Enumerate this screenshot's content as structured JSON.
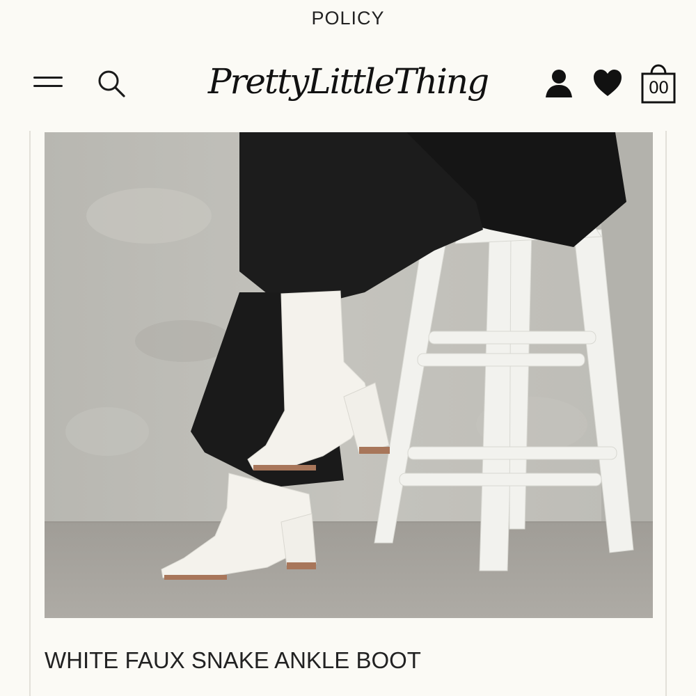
{
  "top_banner": {
    "text": "POLICY"
  },
  "header": {
    "logo_text": "PrettyLittleThing",
    "menu_icon": "hamburger-menu-icon",
    "search_icon": "search-icon",
    "account_icon": "user-icon",
    "wishlist_icon": "heart-icon",
    "bag_icon": "shopping-bag-icon",
    "bag_count": "00"
  },
  "product": {
    "image_alt": "Model wearing white faux snake ankle boots seated on a white wooden stool",
    "title": "WHITE FAUX SNAKE ANKLE BOOT"
  },
  "colors": {
    "background": "#fbfaf5",
    "text": "#1a1a1a",
    "boot": "#f4f2ec",
    "trousers": "#1c1c1c",
    "wall": "#b9b8b2",
    "floor": "#a9a6a0"
  }
}
